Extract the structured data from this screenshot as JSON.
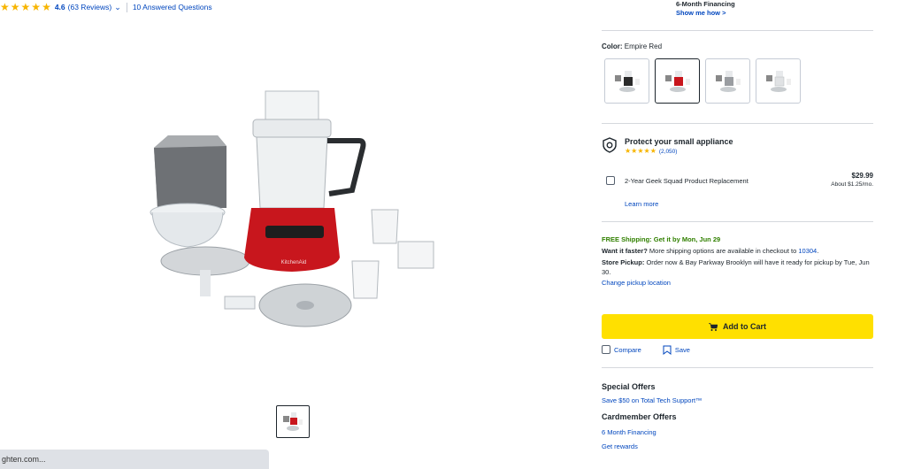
{
  "reviews": {
    "rating": "4.6",
    "count_text": "(63 Reviews)",
    "qa_text": "10 Answered Questions"
  },
  "financing": {
    "title": "6-Month Financing",
    "link": "Show me how >"
  },
  "color": {
    "label": "Color:",
    "selected": "Empire Red",
    "options": [
      "Black",
      "Empire Red",
      "Silver",
      "White"
    ]
  },
  "protection": {
    "title": "Protect your small appliance",
    "rating_count": "(2,050)",
    "plan_label": "2-Year Geek Squad Product Replacement",
    "plan_price": "$29.99",
    "plan_monthly": "About $1.25/mo.",
    "learn_more": "Learn more"
  },
  "shipping": {
    "free_text": "FREE Shipping: Get it by Mon, Jun 29",
    "faster_label": "Want it faster?",
    "faster_text": "More shipping options are available in checkout to",
    "zip": "10304",
    "faster_end": ".",
    "pickup_label": "Store Pickup:",
    "pickup_text": "Order now & Bay Parkway Brooklyn will have it ready for pickup by Tue, Jun 30.",
    "change_location": "Change pickup location"
  },
  "cart": {
    "add_label": "Add to Cart",
    "compare_label": "Compare",
    "save_label": "Save"
  },
  "offers": {
    "special_title": "Special Offers",
    "special_link": "Save $50 on Total Tech Support™",
    "card_title": "Cardmember Offers",
    "card_link1": "6 Month Financing",
    "card_link2": "Get rewards"
  },
  "status_bar": {
    "url": "ghten.com..."
  },
  "colors": {
    "link": "#0046be",
    "cart_button": "#ffe000",
    "star": "#f7b500",
    "shipping_green": "#318000",
    "product_red": "#c8161d"
  }
}
